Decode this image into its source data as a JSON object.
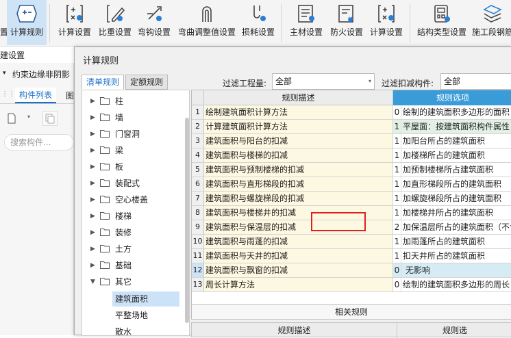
{
  "ribbon": {
    "buttons": [
      {
        "label": "计算规则",
        "icon": "plus-minus-icon"
      },
      {
        "label": "计算设置",
        "icon": "calc-settings-icon"
      },
      {
        "label": "比重设置",
        "icon": "pencil-settings-icon"
      },
      {
        "label": "弯钩设置",
        "icon": "hook-settings-icon"
      },
      {
        "label": "弯曲调整值设置",
        "icon": "bend-adjust-icon"
      },
      {
        "label": "损耗设置",
        "icon": "loss-settings-icon"
      },
      {
        "label": "主材设置",
        "icon": "main-material-icon"
      },
      {
        "label": "防火设置",
        "icon": "fire-settings-icon"
      },
      {
        "label": "计算设置",
        "icon": "calc-settings-icon"
      },
      {
        "label": "结构类型设置",
        "icon": "structure-type-icon"
      },
      {
        "label": "施工段钢筋",
        "icon": "construction-rebar-icon"
      }
    ],
    "left_fragment": "置",
    "group_label": "建设置"
  },
  "left_panel": {
    "dropdown": "约束边缘非阴影",
    "tabs": [
      "构件列表",
      "图"
    ],
    "search_placeholder": "搜索构件..."
  },
  "dialog": {
    "title": "计算规则",
    "tabs": [
      "清单规则",
      "定额规则"
    ],
    "filter1_label": "过滤工程量:",
    "filter1_value": "全部",
    "filter2_label": "过滤扣减构件:",
    "filter2_value": "全部",
    "tree": [
      {
        "label": "柱",
        "expanded": false
      },
      {
        "label": "墙",
        "expanded": false
      },
      {
        "label": "门窗洞",
        "expanded": false
      },
      {
        "label": "梁",
        "expanded": false
      },
      {
        "label": "板",
        "expanded": false
      },
      {
        "label": "装配式",
        "expanded": false
      },
      {
        "label": "空心楼盖",
        "expanded": false
      },
      {
        "label": "楼梯",
        "expanded": false
      },
      {
        "label": "装修",
        "expanded": false
      },
      {
        "label": "土方",
        "expanded": false
      },
      {
        "label": "基础",
        "expanded": false
      },
      {
        "label": "其它",
        "expanded": true
      }
    ],
    "tree_leaves": [
      {
        "label": "建筑面积",
        "selected": true
      },
      {
        "label": "平整场地",
        "selected": false
      },
      {
        "label": "散水",
        "selected": false
      }
    ],
    "grid": {
      "col_desc": "规则描述",
      "col_option": "规则选项",
      "rows": [
        {
          "n": "1",
          "desc": "绘制建筑面积计算方法",
          "code": "0",
          "opt": "绘制的建筑面积多边形的面积"
        },
        {
          "n": "2",
          "desc": "计算建筑面积计算方法",
          "code": "1",
          "opt": "平屋面：按建筑面积构件属性"
        },
        {
          "n": "3",
          "desc": "建筑面积与阳台的扣减",
          "code": "1",
          "opt": "加阳台所占的建筑面积"
        },
        {
          "n": "4",
          "desc": "建筑面积与楼梯的扣减",
          "code": "1",
          "opt": "加楼梯所占的建筑面积"
        },
        {
          "n": "5",
          "desc": "建筑面积与预制楼梯的扣减",
          "code": "1",
          "opt": "加预制楼梯所占建筑面积"
        },
        {
          "n": "6",
          "desc": "建筑面积与直形梯段的扣减",
          "code": "1",
          "opt": "加直形梯段所占的建筑面积"
        },
        {
          "n": "7",
          "desc": "建筑面积与螺旋梯段的扣减",
          "code": "1",
          "opt": "加螺旋梯段所占的建筑面积"
        },
        {
          "n": "8",
          "desc": "建筑面积与楼梯井的扣减",
          "code": "1",
          "opt": "加楼梯井所占的建筑面积"
        },
        {
          "n": "9",
          "desc": "建筑面积与保温层的扣减",
          "code": "2",
          "opt": "加保温层所占的建筑面积（不含"
        },
        {
          "n": "10",
          "desc": "建筑面积与雨蓬的扣减",
          "code": "1",
          "opt": "加雨蓬所占的建筑面积"
        },
        {
          "n": "11",
          "desc": "建筑面积与天井的扣减",
          "code": "1",
          "opt": "扣天井所占的建筑面积"
        },
        {
          "n": "12",
          "desc": "建筑面积与飘窗的扣减",
          "code": "0",
          "opt": "无影响"
        },
        {
          "n": "13",
          "desc": "周长计算方法",
          "code": "0",
          "opt": "绘制的建筑面积多边形的周长"
        }
      ]
    },
    "related_label": "相关规则",
    "bottom_col_desc": "规则描述",
    "bottom_col_option": "规则选"
  }
}
